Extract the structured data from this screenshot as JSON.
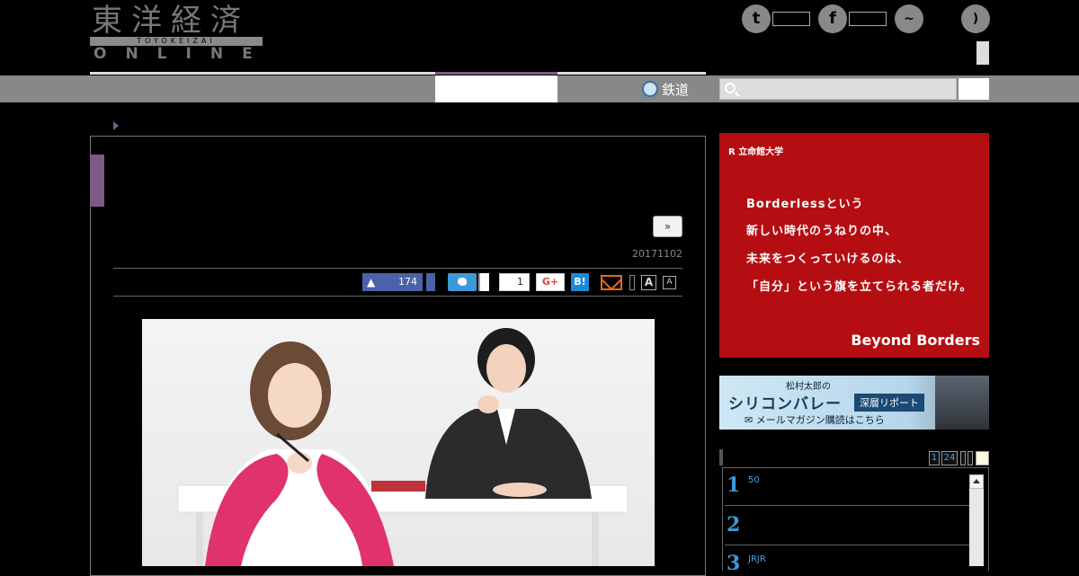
{
  "header": {
    "logo_kanji": "東洋経済",
    "logo_sub": "TOYOKEIZAI",
    "logo_online": "ONLINE"
  },
  "nav": {
    "rail_label": "鉄道"
  },
  "article": {
    "next_label": "»",
    "date": "20171102",
    "like_count": "174",
    "pocket_count": "1",
    "gplus_label": "G+",
    "hatena_label": "B!",
    "font_large_label": "A",
    "font_small_label": "A"
  },
  "ad": {
    "university": "立命館大学",
    "lines": [
      "Borderlessという",
      "新しい時代のうねりの中、",
      "未来をつくっていけるのは、",
      "「自分」という旗を立てられる者だけ。"
    ],
    "tagline": "Beyond Borders"
  },
  "banner": {
    "top": "松村太郎の",
    "main": "シリコンバレー",
    "tag": "深層リポート",
    "bottom": "メールマガジン購読はこちら"
  },
  "ranking": {
    "tabs": [
      "1",
      "24"
    ],
    "items": [
      {
        "num": "1",
        "text": "50"
      },
      {
        "num": "2",
        "text": ""
      },
      {
        "num": "3",
        "text": "JRJR"
      }
    ]
  },
  "colors": {
    "accent": "#7b5b86",
    "ad_red": "#b50e12",
    "link_blue": "#3d9ad9"
  }
}
